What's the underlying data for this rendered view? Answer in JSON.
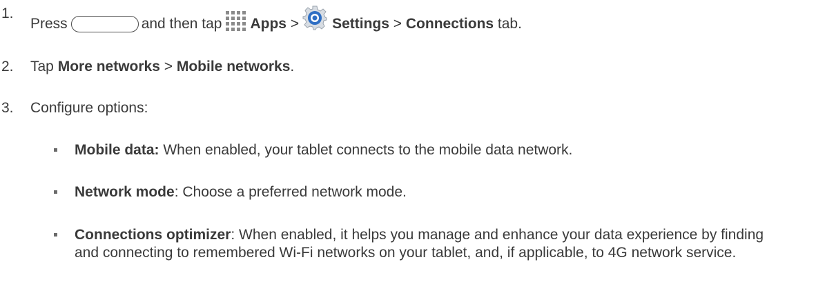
{
  "steps": [
    {
      "number": "1.",
      "parts": {
        "press": "Press",
        "and_then_tap": "and then tap",
        "apps": "Apps",
        "sep1": ">",
        "settings": "Settings",
        "sep2": ">",
        "connections": "Connections",
        "tab": "tab."
      }
    },
    {
      "number": "2.",
      "parts": {
        "tap": "Tap",
        "more_networks": "More networks",
        "sep": ">",
        "mobile_networks": "Mobile networks",
        "period": "."
      }
    },
    {
      "number": "3.",
      "text": "Configure options:"
    }
  ],
  "options": [
    {
      "label": "Mobile data:",
      "description": " When enabled, your tablet connects to the mobile data network."
    },
    {
      "label": "Network mode",
      "description": ": Choose a preferred network mode."
    },
    {
      "label": "Connections optimizer",
      "description": ": When enabled, it helps you manage and enhance your data experience by finding and connecting to remembered Wi-Fi networks on your tablet, and, if applicable, to 4G network service."
    }
  ],
  "icons": {
    "home_button": "home-button-icon",
    "apps": "apps-grid-icon",
    "settings": "settings-gear-icon",
    "settings_color": "#2f6fc4"
  }
}
